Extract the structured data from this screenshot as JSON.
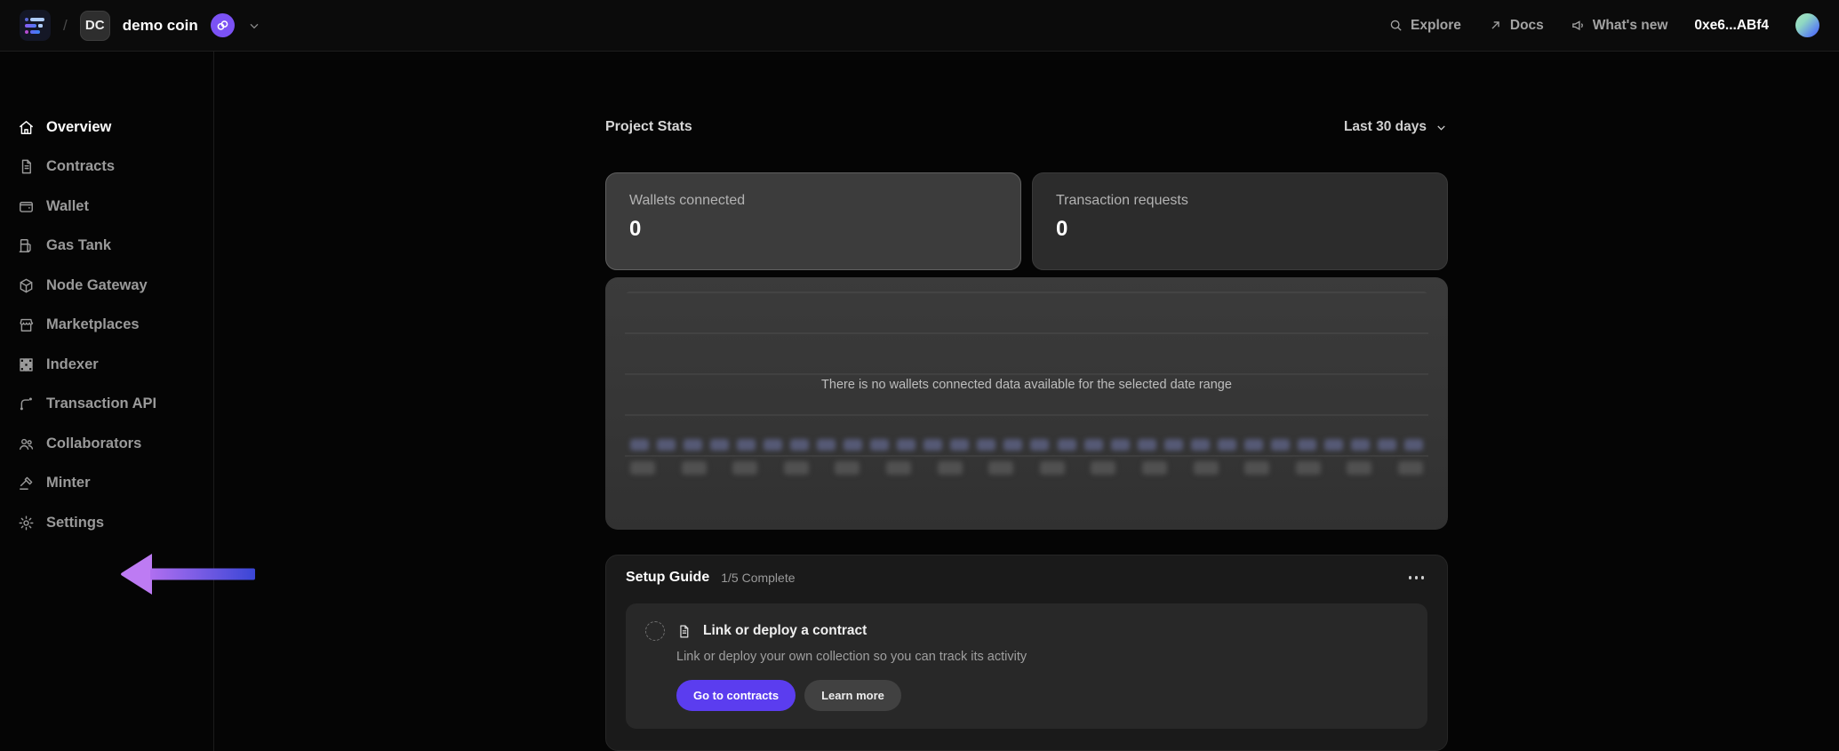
{
  "topbar": {
    "breadcrumb": {
      "logo_icon": "product-logo-icon",
      "separator": "/",
      "team_initials": "DC",
      "project_name": "demo coin",
      "badge_icon": "loop-badge-icon",
      "chevron_icon": "chevron-down-icon"
    },
    "nav": [
      {
        "label": "Explore",
        "icon": "search-icon"
      },
      {
        "label": "Docs",
        "icon": "external-arrow-icon"
      },
      {
        "label": "What's new",
        "icon": "megaphone-icon"
      }
    ],
    "wallet_address": "0xe6...ABf4",
    "avatar_icon": "account-avatar"
  },
  "sidebar": {
    "items": [
      {
        "label": "Overview",
        "icon": "home-icon",
        "active": true
      },
      {
        "label": "Contracts",
        "icon": "contract-icon",
        "active": false
      },
      {
        "label": "Wallet",
        "icon": "wallet-icon",
        "active": false
      },
      {
        "label": "Gas Tank",
        "icon": "gas-pump-icon",
        "active": false
      },
      {
        "label": "Node Gateway",
        "icon": "cube-icon",
        "active": false
      },
      {
        "label": "Marketplaces",
        "icon": "storefront-icon",
        "active": false
      },
      {
        "label": "Indexer",
        "icon": "grid-icon",
        "active": false
      },
      {
        "label": "Transaction API",
        "icon": "route-icon",
        "active": false
      },
      {
        "label": "Collaborators",
        "icon": "users-icon",
        "active": false
      },
      {
        "label": "Minter",
        "icon": "gavel-icon",
        "active": false
      },
      {
        "label": "Settings",
        "icon": "gear-icon",
        "active": false
      }
    ],
    "annotation_arrow": {
      "target": "Settings",
      "direction": "left",
      "color_from": "#bd7bf3",
      "color_to": "#3a46d6"
    }
  },
  "main": {
    "stats_section": {
      "title": "Project Stats",
      "range_label": "Last 30 days",
      "range_chevron_icon": "chevron-down-icon",
      "cards": [
        {
          "label": "Wallets connected",
          "value": "0",
          "selected": true
        },
        {
          "label": "Transaction requests",
          "value": "0",
          "selected": false
        }
      ],
      "chart_empty_message": "There is no wallets connected data available for the selected date range"
    },
    "setup_guide": {
      "title": "Setup Guide",
      "progress": "1/5 Complete",
      "menu_icon": "ellipsis-icon",
      "task": {
        "status_icon": "incomplete-step-circle",
        "doc_icon": "document-icon",
        "title": "Link or deploy a contract",
        "description": "Link or deploy your own collection so you can track its activity",
        "primary_button": "Go to contracts",
        "secondary_button": "Learn more"
      }
    }
  },
  "colors": {
    "accent_button": "#5b3def",
    "badge_purple": "#7b52f4",
    "page_background": "#050505",
    "card_background": "#2c2c2c",
    "selected_card_background": "#3c3c3c"
  }
}
